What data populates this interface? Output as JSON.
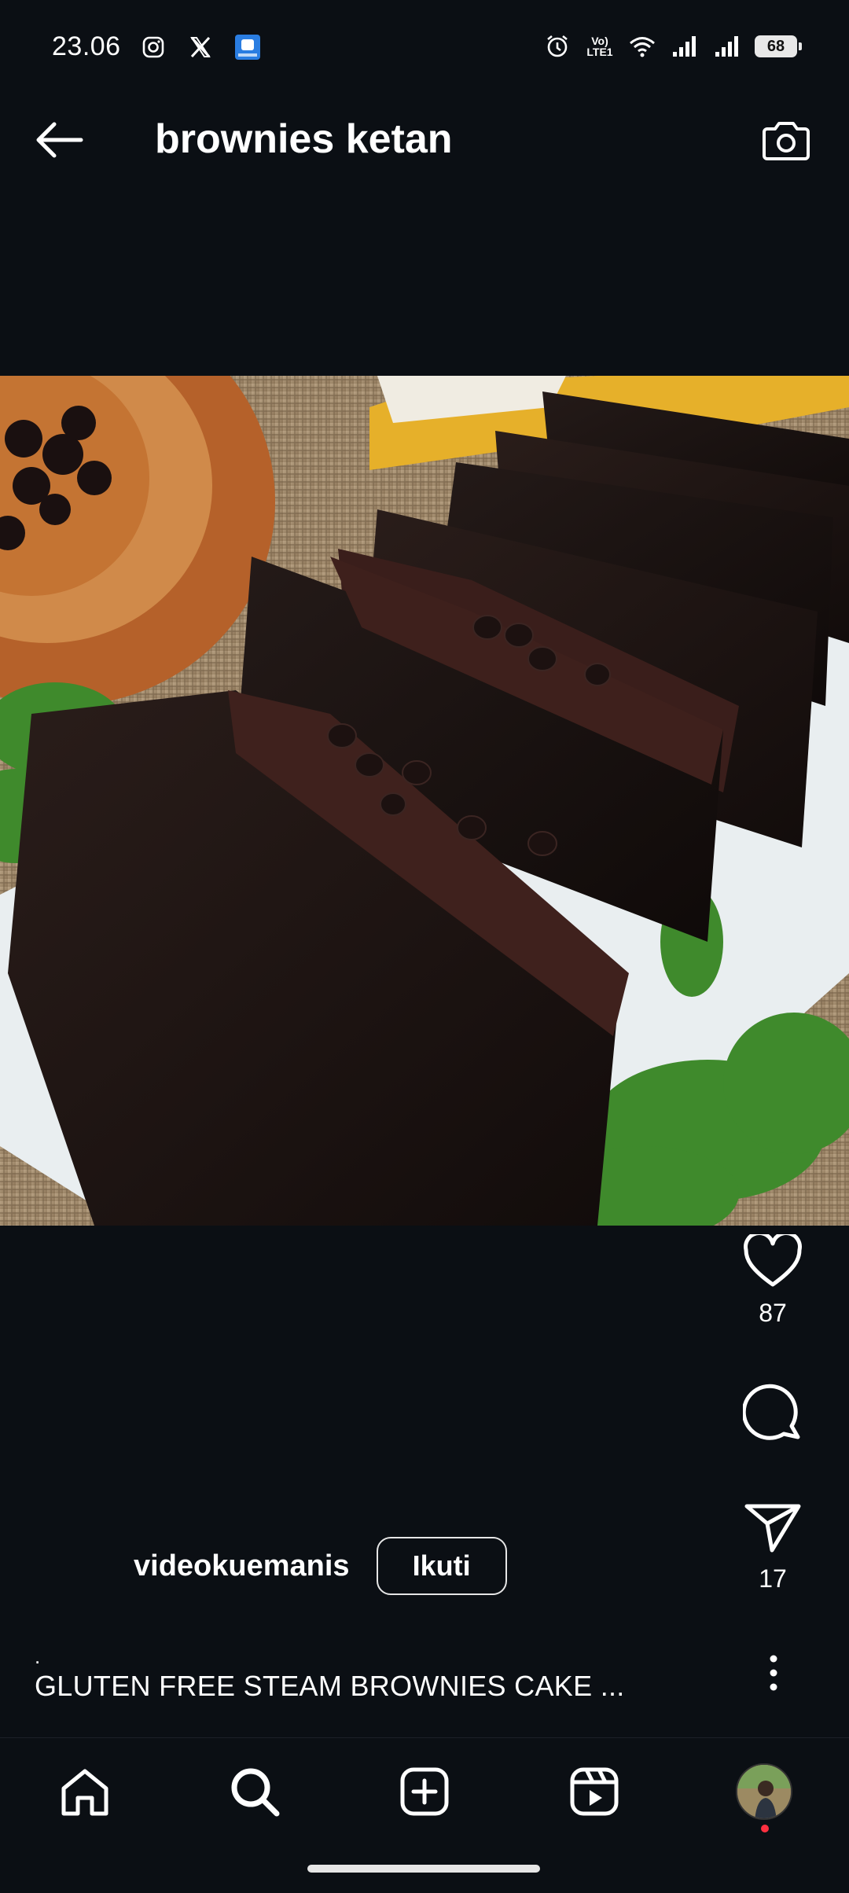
{
  "status_bar": {
    "time": "23.06",
    "battery": "68",
    "network_label_top": "Vo)",
    "network_label_bottom": "LTE1"
  },
  "header": {
    "title": "brownies ketan"
  },
  "post": {
    "likes": "87",
    "shares": "17",
    "author": "videokuemanis",
    "follow_label": "Ikuti",
    "caption_dot": ".",
    "caption": "GLUTEN FREE STEAM BROWNIES CAKE ..."
  },
  "icons": {
    "back": "arrow-left-icon",
    "camera": "camera-icon",
    "like": "heart-icon",
    "comment": "comment-icon",
    "share": "send-icon",
    "more": "more-vertical-icon",
    "home": "home-icon",
    "search": "search-icon",
    "create": "plus-square-icon",
    "reels": "reels-icon",
    "profile": "avatar"
  },
  "colors": {
    "background": "#0b0f14",
    "text": "#ffffff",
    "notification": "#ff3040"
  }
}
